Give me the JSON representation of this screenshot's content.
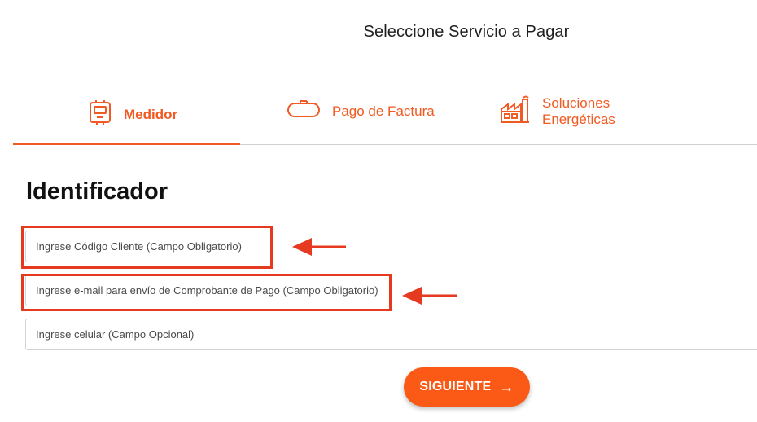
{
  "header": {
    "title": "Seleccione Servicio a Pagar"
  },
  "tabs": [
    {
      "label": "Medidor",
      "icon": "meter-icon",
      "active": true
    },
    {
      "label": "Pago de Factura",
      "icon": "invoice-icon",
      "active": false
    },
    {
      "label_line1": "Soluciones",
      "label_line2": "Energéticas",
      "icon": "factory-icon",
      "active": false
    }
  ],
  "form": {
    "section_title": "Identificador",
    "fields": [
      {
        "placeholder": "Ingrese Código Cliente (Campo Obligatorio)",
        "value": ""
      },
      {
        "placeholder": "Ingrese e-mail para envío de Comprobante de Pago (Campo Obligatorio)",
        "value": ""
      },
      {
        "placeholder": "Ingrese celular (Campo Opcional)",
        "value": ""
      }
    ],
    "submit_label": "SIGUIENTE",
    "submit_icon": "arrow-right-icon"
  },
  "colors": {
    "accent": "#f15a22",
    "button": "#fb5a16",
    "annotation": "#e53a20"
  }
}
